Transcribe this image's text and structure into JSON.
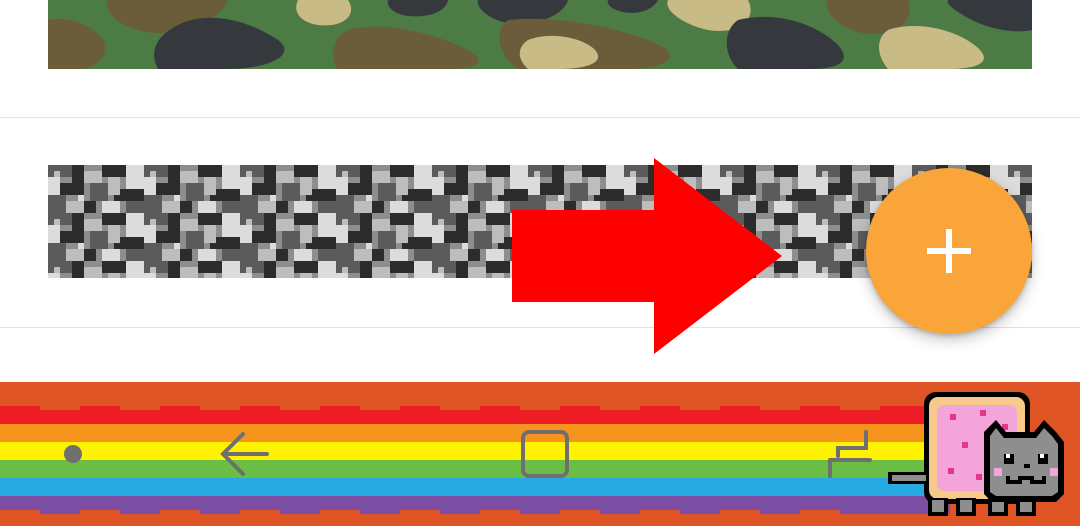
{
  "list": {
    "items": [
      {
        "pattern": "woodland-camo",
        "colors": [
          "#4d7b45",
          "#6b5c3a",
          "#c9bb86",
          "#35393d"
        ]
      },
      {
        "pattern": "digital-urban-camo",
        "colors": [
          "#2c2c2c",
          "#5b5b5b",
          "#8e8e8e",
          "#bdbdbd",
          "#dcdcdc"
        ]
      }
    ]
  },
  "overlay": {
    "arrow_icon": "right-arrow",
    "arrow_color": "#ff0000"
  },
  "fab": {
    "icon": "plus-icon",
    "color": "#f9a53a"
  },
  "navbar": {
    "theme": "nyan-cat",
    "background": "#de5424",
    "rainbow_colors": [
      "#ee1c24",
      "#f7941d",
      "#fff200",
      "#6bbe45",
      "#27aae1",
      "#7b4ea3"
    ],
    "buttons": [
      "menu-dot-icon",
      "back-icon",
      "home-icon",
      "recent-apps-icon"
    ]
  }
}
